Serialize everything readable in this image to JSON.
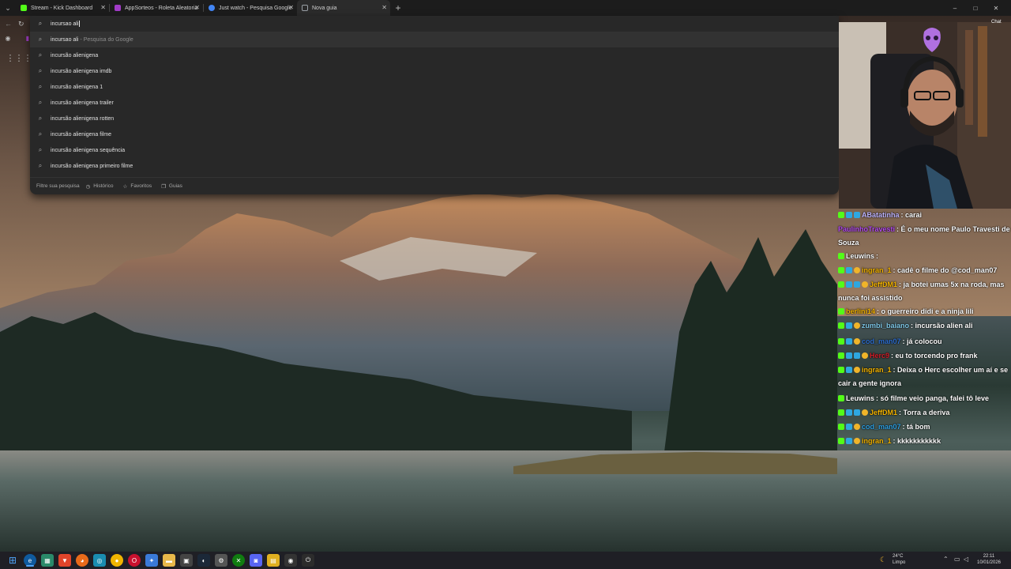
{
  "browser": {
    "tabs": [
      {
        "title": "Stream - Kick Dashboard",
        "favicon_color": "#53fc18",
        "active": false
      },
      {
        "title": "AppSorteos - Roleta Aleatoria",
        "favicon_color": "#a23cc8",
        "active": false
      },
      {
        "title": "Just watch - Pesquisa Google",
        "favicon_color": "#4285f4",
        "active": false
      },
      {
        "title": "Nova guia",
        "favicon_color": "#9aa0a6",
        "active": true
      }
    ],
    "new_tab_label": "+",
    "window_controls": [
      "–",
      "□",
      "✕"
    ]
  },
  "omnibox": {
    "query": "incursao ali",
    "suggestions": [
      {
        "text": "incursao ali",
        "annotation": "- Pesquisa do Google"
      },
      {
        "text": "incursão alienigena",
        "annotation": ""
      },
      {
        "text": "incursão alienigena imdb",
        "annotation": ""
      },
      {
        "text": "incursão alienigena 1",
        "annotation": ""
      },
      {
        "text": "incursão alienigena trailer",
        "annotation": ""
      },
      {
        "text": "incursão alienigena rotten",
        "annotation": ""
      },
      {
        "text": "incursão alienigena filme",
        "annotation": ""
      },
      {
        "text": "incursão alienigena sequência",
        "annotation": ""
      },
      {
        "text": "incursão alienigena primeiro filme",
        "annotation": ""
      }
    ],
    "footer": {
      "filter_placeholder": "Filtre sua pesquisa",
      "historico": "Histórico",
      "favoritos": "Favoritos",
      "guias": "Guias"
    }
  },
  "overlay": {
    "chat_button": "Chat"
  },
  "chat": {
    "messages": [
      {
        "user": "ABatatinha",
        "user_color": "#c0b6ff",
        "text": ": carai",
        "badges": [
          "k",
          "sub",
          "sub"
        ]
      },
      {
        "user": "PaulinhoTravesti",
        "user_color": "#b44cf0",
        "text": ": É o meu nome Paulo Travesti de Souza",
        "badges": []
      },
      {
        "user": "Leuwins",
        "user_color": "#ffffff",
        "text": ":",
        "badges": [
          "k"
        ]
      },
      {
        "user": "ingran_1",
        "user_color": "#f4b400",
        "text": ": cadê o filme do @cod_man07",
        "badges": [
          "k",
          "sub",
          "v"
        ]
      },
      {
        "user": "JeffDM1",
        "user_color": "#f4b400",
        "text": ": ja botei umas 5x na roda, mas nunca foi assistido",
        "badges": [
          "k",
          "sub",
          "sub",
          "v"
        ]
      },
      {
        "user": "berlini14",
        "user_color": "#f4b400",
        "text": ": o guerreiro didi e a ninja lili",
        "badges": [
          "k"
        ]
      },
      {
        "user": "zumbi_baiano",
        "user_color": "#7fc8e8",
        "text": ": incursão alien ali",
        "badges": [
          "k",
          "sub",
          "v"
        ]
      },
      {
        "user": "cod_man07",
        "user_color": "#2e6fd0",
        "text": ": já colocou",
        "badges": [
          "k",
          "sub",
          "v"
        ]
      },
      {
        "user": "Herc9",
        "user_color": "#d0202a",
        "text": ": eu to torcendo pro frank",
        "badges": [
          "k",
          "sub",
          "sub",
          "v"
        ]
      },
      {
        "user": "ingran_1",
        "user_color": "#f4b400",
        "text": ": Deixa o Herc escolher um aí e se cair a gente ignora",
        "badges": [
          "k",
          "sub",
          "v"
        ]
      },
      {
        "user": "Leuwins",
        "user_color": "#ffffff",
        "text": ": só filme veio panga, falei tô leve",
        "badges": [
          "k"
        ]
      },
      {
        "user": "JeffDM1",
        "user_color": "#f4b400",
        "text": ": Torra a deriva",
        "badges": [
          "k",
          "sub",
          "sub",
          "v"
        ]
      },
      {
        "user": "cod_man07",
        "user_color": "#2e9fe0",
        "text": ": tá bom",
        "badges": [
          "k",
          "sub",
          "v"
        ]
      },
      {
        "user": "ingran_1",
        "user_color": "#f4b400",
        "text": ": kkkkkkkkkkk",
        "badges": [
          "k",
          "sub",
          "v"
        ]
      }
    ]
  },
  "taskbar": {
    "weather_temp": "24°C",
    "weather_desc": "Limpo",
    "time": "22:11",
    "date": "10/01/2026"
  },
  "colors": {
    "accent_kick": "#53fc18",
    "omnibox_bg": "#282828",
    "tabbar_bg": "#1c1c1c",
    "taskbar_bg": "#1f1f25"
  }
}
